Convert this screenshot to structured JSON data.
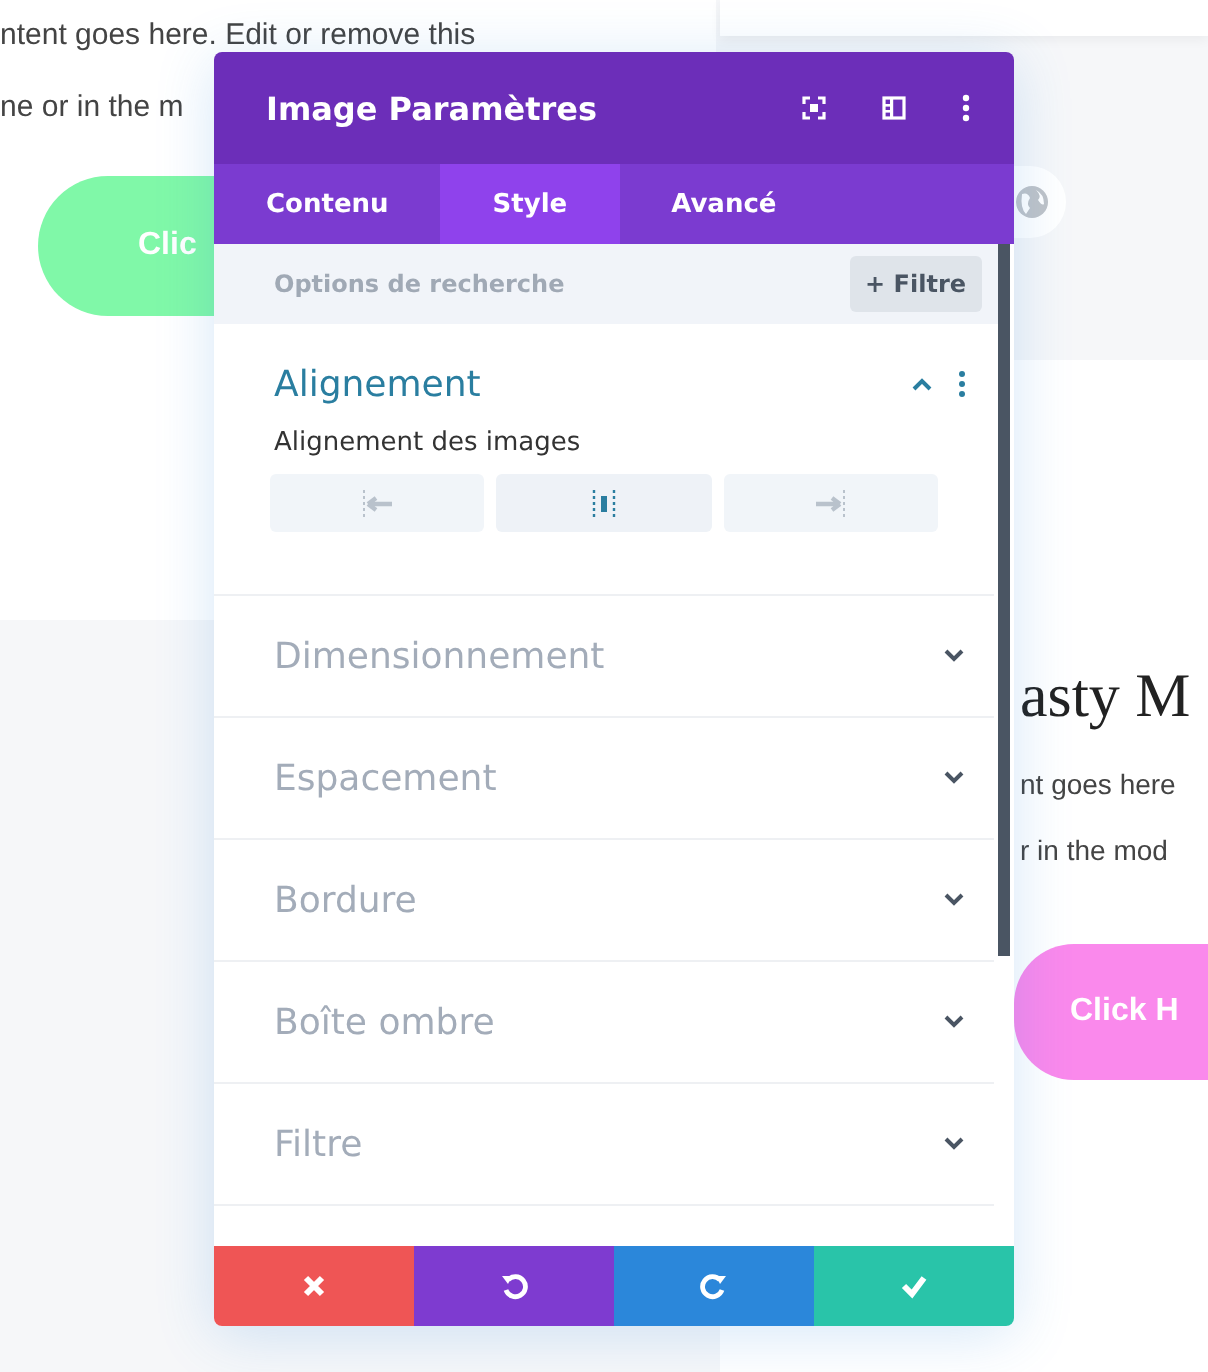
{
  "background": {
    "left_card": {
      "lines": [
        "ntent goes here. Edit or remove this",
        "ne or in the m"
      ],
      "button": "Clic"
    },
    "right_card": {
      "heading": "asty M",
      "lines": [
        "nt goes here",
        "r in the mod"
      ],
      "button": "Click H"
    }
  },
  "panel": {
    "title": "Image Paramètres",
    "tabs": [
      {
        "label": "Contenu",
        "selected": false
      },
      {
        "label": "Style",
        "selected": true
      },
      {
        "label": "Avancé",
        "selected": false
      }
    ],
    "search": {
      "placeholder": "Options de recherche"
    },
    "filter_button": "+ Filtre",
    "sections": [
      {
        "title": "Alignement",
        "expanded": true,
        "field_label": "Alignement des images",
        "options": [
          {
            "kind": "left",
            "selected": false
          },
          {
            "kind": "center",
            "selected": true
          },
          {
            "kind": "right",
            "selected": false
          }
        ]
      },
      {
        "title": "Dimensionnement",
        "expanded": false
      },
      {
        "title": "Espacement",
        "expanded": false
      },
      {
        "title": "Bordure",
        "expanded": false
      },
      {
        "title": "Boîte ombre",
        "expanded": false
      },
      {
        "title": "Filtre",
        "expanded": false
      }
    ],
    "footer": [
      {
        "kind": "cancel"
      },
      {
        "kind": "undo"
      },
      {
        "kind": "redo"
      },
      {
        "kind": "save"
      }
    ]
  }
}
